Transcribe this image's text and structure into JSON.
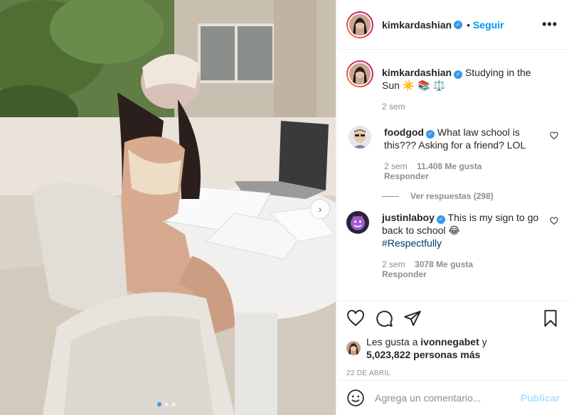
{
  "header": {
    "username": "kimkardashian",
    "separator": "•",
    "follow_label": "Seguir",
    "more_icon": "more-horizontal-icon"
  },
  "caption": {
    "username": "kimkardashian",
    "text": "Studying in the Sun ☀️ 📚 ⚖️",
    "time": "2 sem"
  },
  "comments": [
    {
      "username": "foodgod",
      "text": "What law school is this??? Asking for a friend? LOL",
      "time": "2 sem",
      "likes": "11.408 Me gusta",
      "reply_label": "Responder",
      "view_replies": "Ver respuestas (298)"
    },
    {
      "username": "justinlaboy",
      "text": "This is my sign to go back to school 😂",
      "hashtag": "#Respectfully",
      "time": "2 sem",
      "likes": "3078 Me gusta",
      "reply_label": "Responder"
    }
  ],
  "likes": {
    "prefix": "Les gusta a",
    "user": "ivonnegabet",
    "connector": "y",
    "others": "5,023,822 personas más"
  },
  "date": "22 DE ABRIL",
  "add_comment": {
    "placeholder": "Agrega un comentario...",
    "post_label": "Publicar"
  },
  "carousel": {
    "current": 1,
    "total": 3
  },
  "colors": {
    "accent": "#0095f6",
    "verified": "#3897f0",
    "post_disabled": "#b2dffc",
    "hashtag": "#00376b",
    "muted": "#8e8e8e"
  }
}
